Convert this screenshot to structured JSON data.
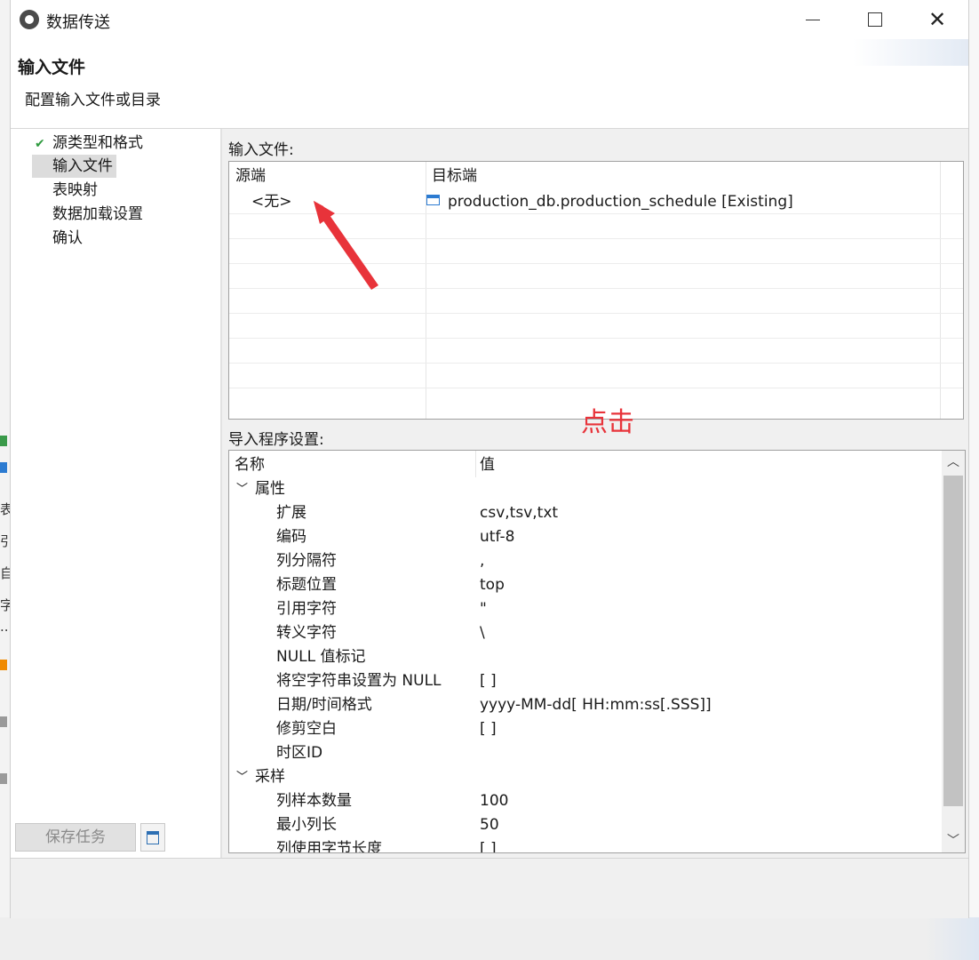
{
  "window": {
    "title": "数据传送",
    "minimize": "",
    "maximize": "",
    "close": "✕"
  },
  "header": {
    "title": "输入文件",
    "subtitle": "配置输入文件或目录"
  },
  "nav": {
    "items": [
      {
        "label": "源类型和格式",
        "done": true,
        "selected": false
      },
      {
        "label": "输入文件",
        "done": false,
        "selected": true
      },
      {
        "label": "表映射",
        "done": false,
        "selected": false
      },
      {
        "label": "数据加载设置",
        "done": false,
        "selected": false
      },
      {
        "label": "确认",
        "done": false,
        "selected": false
      }
    ],
    "save_task_label": "保存任务"
  },
  "input_files": {
    "section_label": "输入文件:",
    "columns": [
      "源端",
      "目标端"
    ],
    "rows": [
      {
        "source": "<无>",
        "target": "production_db.production_schedule [Existing]"
      }
    ]
  },
  "annotation": {
    "text": "点击",
    "color": "#e8333a"
  },
  "importer_settings": {
    "section_label": "导入程序设置:",
    "columns": [
      "名称",
      "值"
    ],
    "groups": [
      {
        "name": "属性",
        "items": [
          {
            "name": "扩展",
            "value": "csv,tsv,txt"
          },
          {
            "name": "编码",
            "value": "utf-8"
          },
          {
            "name": "列分隔符",
            "value": ","
          },
          {
            "name": "标题位置",
            "value": "top"
          },
          {
            "name": "引用字符",
            "value": "\""
          },
          {
            "name": "转义字符",
            "value": "\\"
          },
          {
            "name": "NULL 值标记",
            "value": ""
          },
          {
            "name": "将空字符串设置为 NULL",
            "value": "[ ]"
          },
          {
            "name": "日期/时间格式",
            "value": "yyyy-MM-dd[ HH:mm:ss[.SSS]]"
          },
          {
            "name": "修剪空白",
            "value": "[ ]"
          },
          {
            "name": "时区ID",
            "value": ""
          }
        ]
      },
      {
        "name": "采样",
        "items": [
          {
            "name": "列样本数量",
            "value": "100"
          },
          {
            "name": "最小列长",
            "value": "50"
          },
          {
            "name": "列使用字节长度",
            "value": "[ ]"
          }
        ]
      }
    ]
  },
  "background_fragments": [
    "表",
    "引",
    "自",
    "字",
    "..."
  ]
}
